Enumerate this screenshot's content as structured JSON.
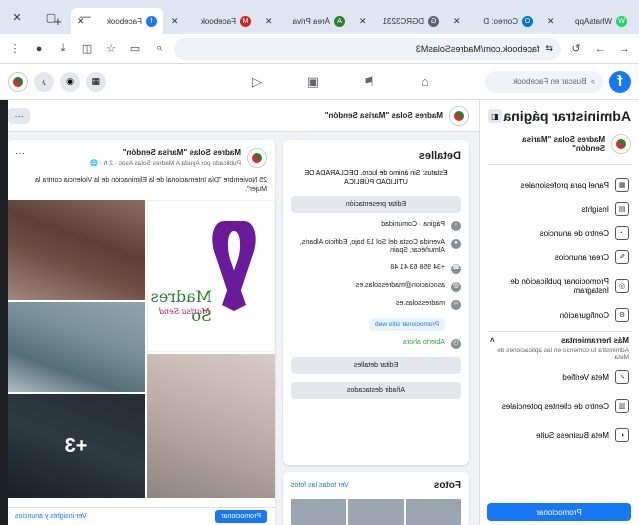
{
  "tabs": [
    {
      "title": "WhatsApp",
      "color": "#25d366",
      "glyph": "W"
    },
    {
      "title": "Correo: D",
      "color": "#0078d4",
      "glyph": "O"
    },
    {
      "title": "DGRC3231",
      "color": "#5f6368",
      "glyph": "G"
    },
    {
      "title": "Área Priva",
      "color": "#2e7d32",
      "glyph": "A"
    },
    {
      "title": "Facebook",
      "color": "#c62828",
      "glyph": "M"
    },
    {
      "title": "Facebook",
      "color": "#1877f2",
      "glyph": "f"
    }
  ],
  "address": {
    "url": "facebook.com/MadresSolasM3"
  },
  "fb": {
    "search_placeholder": "Buscar en Facebook"
  },
  "left_panel": {
    "title": "Administrar página",
    "page_name": "Madres Solas \"Marisa Sendón\"",
    "items": [
      {
        "label": "Panel para profesionales",
        "icon": "dashboard-icon",
        "glyph": "▦"
      },
      {
        "label": "Insights",
        "icon": "insights-icon",
        "glyph": "▤"
      },
      {
        "label": "Centro de anuncios",
        "icon": "megaphone-icon",
        "glyph": "◔"
      },
      {
        "label": "Crear anuncios",
        "icon": "edit-icon",
        "glyph": "✎"
      },
      {
        "label": "Promocionar publicación de Instagram",
        "icon": "instagram-icon",
        "glyph": "◎"
      },
      {
        "label": "Configuración",
        "icon": "gear-icon",
        "glyph": "⚙"
      }
    ],
    "more_tools": {
      "title": "Más herramientas",
      "desc": "Administra tu comercio en las aplicaciones de Meta"
    },
    "extra_items": [
      {
        "label": "Meta Verified",
        "icon": "verified-icon",
        "glyph": "✓"
      },
      {
        "label": "Centro de clientes potenciales",
        "icon": "leads-icon",
        "glyph": "▥"
      },
      {
        "label": "Meta Business Suite",
        "icon": "business-suite-icon",
        "glyph": "◐"
      }
    ],
    "promote_label": "Promocionar"
  },
  "page_header": {
    "name": "Madres Solas \"Marisa Sendón\""
  },
  "details": {
    "title": "Detalles",
    "bio": "Estatus: Sin ánimo de lucro. DECLARADA DE UTILIDAD PÚBLICA",
    "edit_bio": "Editar presentación",
    "category": "Página · Comunidad",
    "address": "Avenida Costa del Sol 13 bajo, Edificio Albaris, Almuñécar, Spain",
    "phone": "+34 958 63 41 48",
    "email": "asociacion@madressolas.es",
    "website": "madressolas.es",
    "whatsapp_btn": "Promocionar sitio web",
    "hours": "Abierto ahora",
    "edit_details": "Editar detalles",
    "add_featured": "Añadir destacados"
  },
  "photos": {
    "title": "Fotos",
    "see_all": "Ver todas las fotos"
  },
  "post": {
    "author": "Madres Solas \"Marisa Sendón\"",
    "meta": "Publicado por Ayuda A Madres Solas Asoc · 2 h · 🌐",
    "text": "25 Noviembre \"Día Internacional de la Eliminación de la Violencia contra la Mujer\".",
    "more_photos": "+3",
    "poster_title": "Madres So",
    "poster_sub": "Marisa Send",
    "insights_link": "Ver insights y anuncios",
    "promote_btn": "Promocionar"
  }
}
